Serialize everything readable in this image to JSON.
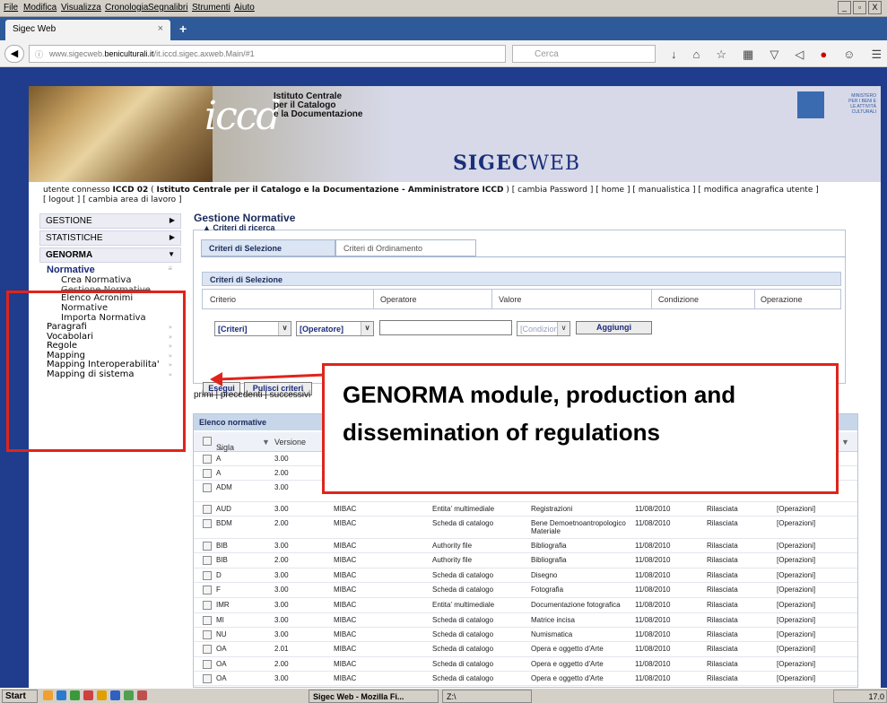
{
  "browser": {
    "menu": [
      "File",
      "Modifica",
      "Visualizza",
      "Cronologia",
      "Segnalibri",
      "Strumenti",
      "Aiuto"
    ],
    "tab_title": "Sigec Web",
    "url_prefix": "www.sigecweb.",
    "url_domain": "beniculturali.it",
    "url_suffix": "/it.iccd.sigec.axweb.Main/#1",
    "search_placeholder": "Cerca",
    "window_buttons": [
      "_",
      "▫",
      "X"
    ]
  },
  "banner": {
    "logo_text": "iccd",
    "institute_lines": [
      "Istituto Centrale",
      "per il Catalogo",
      "e la Documentazione"
    ],
    "app_title_strong": "SIGEC",
    "app_title_rest": "WEB",
    "ministry": [
      "MINISTERO",
      "PER I BENI E",
      "LE ATTIVITÀ",
      "CULTURALI"
    ]
  },
  "user_line": {
    "prefix": "utente connesso ",
    "user": "ICCD 02",
    "paren_open": " ( ",
    "org": "Istituto Centrale per il Catalogo e la Documentazione - Amministratore ICCD",
    "rest": " ) [ cambia Password ] [ home ] [ manualistica ] [ modifica anagrafica utente ]",
    "line2": "[ logout ] [ cambia area di lavoro ]"
  },
  "sidebar": {
    "sections": [
      "GESTIONE",
      "STATISTICHE",
      "GENORMA"
    ],
    "normative_label": "Normative",
    "normative_items": [
      "Crea Normativa",
      "Gestione Normative",
      "Elenco Acronimi Normative",
      "Importa Normativa"
    ],
    "groups": [
      "Paragrafi",
      "Vocabolari",
      "Regole",
      "Mapping",
      "Mapping Interoperabilita'",
      "Mapping di sistema"
    ]
  },
  "main": {
    "title": "Gestione Normative",
    "fieldset_legend": "Criteri di ricerca",
    "tabs": [
      "Criteri di Selezione",
      "Criteri di Ordinamento"
    ],
    "selection_header": "Criteri di Selezione",
    "columns": [
      "Criterio",
      "Operatore",
      "Valore",
      "Condizione",
      "Operazione"
    ],
    "criteria_select": "[Criteri]",
    "operator_select": "[Operatore]",
    "value_input": "",
    "condition_select": "[Condizione]",
    "add_button": "Aggiungi",
    "run_button": "Esegui",
    "clear_button": "Pulisci criteri",
    "pager": "primi | precedenti | successivi"
  },
  "list": {
    "title": "Elenco normative",
    "headers": [
      "Sigla",
      "Versione"
    ],
    "rows": [
      [
        "A",
        "3.00",
        "",
        "",
        "",
        "",
        "",
        ""
      ],
      [
        "A",
        "2.00",
        "",
        "",
        "",
        "",
        "",
        ""
      ],
      [
        "ADM",
        "3.00",
        "",
        "",
        "",
        "",
        "",
        ""
      ],
      [
        "AUD",
        "3.00",
        "MIBAC",
        "Entita' multimediale",
        "Registrazioni",
        "11/08/2010",
        "Rilasciata",
        "[Operazioni]"
      ],
      [
        "BDM",
        "2.00",
        "MIBAC",
        "Scheda di catalogo",
        "Bene Demoetnoantropologico Materiale",
        "11/08/2010",
        "Rilasciata",
        "[Operazioni]"
      ],
      [
        "BIB",
        "3.00",
        "MIBAC",
        "Authority file",
        "Bibliografia",
        "11/08/2010",
        "Rilasciata",
        "[Operazioni]"
      ],
      [
        "BIB",
        "2.00",
        "MIBAC",
        "Authority file",
        "Bibliografia",
        "11/08/2010",
        "Rilasciata",
        "[Operazioni]"
      ],
      [
        "D",
        "3.00",
        "MIBAC",
        "Scheda di catalogo",
        "Disegno",
        "11/08/2010",
        "Rilasciata",
        "[Operazioni]"
      ],
      [
        "F",
        "3.00",
        "MIBAC",
        "Scheda di catalogo",
        "Fotografia",
        "11/08/2010",
        "Rilasciata",
        "[Operazioni]"
      ],
      [
        "IMR",
        "3.00",
        "MIBAC",
        "Entita' multimediale",
        "Documentazione fotografica",
        "11/08/2010",
        "Rilasciata",
        "[Operazioni]"
      ],
      [
        "MI",
        "3.00",
        "MIBAC",
        "Scheda di catalogo",
        "Matrice incisa",
        "11/08/2010",
        "Rilasciata",
        "[Operazioni]"
      ],
      [
        "NU",
        "3.00",
        "MIBAC",
        "Scheda di catalogo",
        "Numismatica",
        "11/08/2010",
        "Rilasciata",
        "[Operazioni]"
      ],
      [
        "OA",
        "2.01",
        "MIBAC",
        "Scheda di catalogo",
        "Opera e oggetto d'Arte",
        "11/08/2010",
        "Rilasciata",
        "[Operazioni]"
      ],
      [
        "OA",
        "2.00",
        "MIBAC",
        "Scheda di catalogo",
        "Opera e oggetto d'Arte",
        "11/08/2010",
        "Rilasciata",
        "[Operazioni]"
      ],
      [
        "OA",
        "3.00",
        "MIBAC",
        "Scheda di catalogo",
        "Opera e oggetto d'Arte",
        "11/08/2010",
        "Rilasciata",
        "[Operazioni]"
      ]
    ],
    "partial_ops": [
      "i]",
      "i]",
      "i]"
    ]
  },
  "annotation": {
    "text": "GENORMA module, production and dissemination of regulations",
    "color": "#e0241b"
  },
  "taskbar": {
    "start": "Start",
    "task1": "Sigec Web - Mozilla Fi...",
    "task2": "Z:\\",
    "clock": "17.0"
  }
}
